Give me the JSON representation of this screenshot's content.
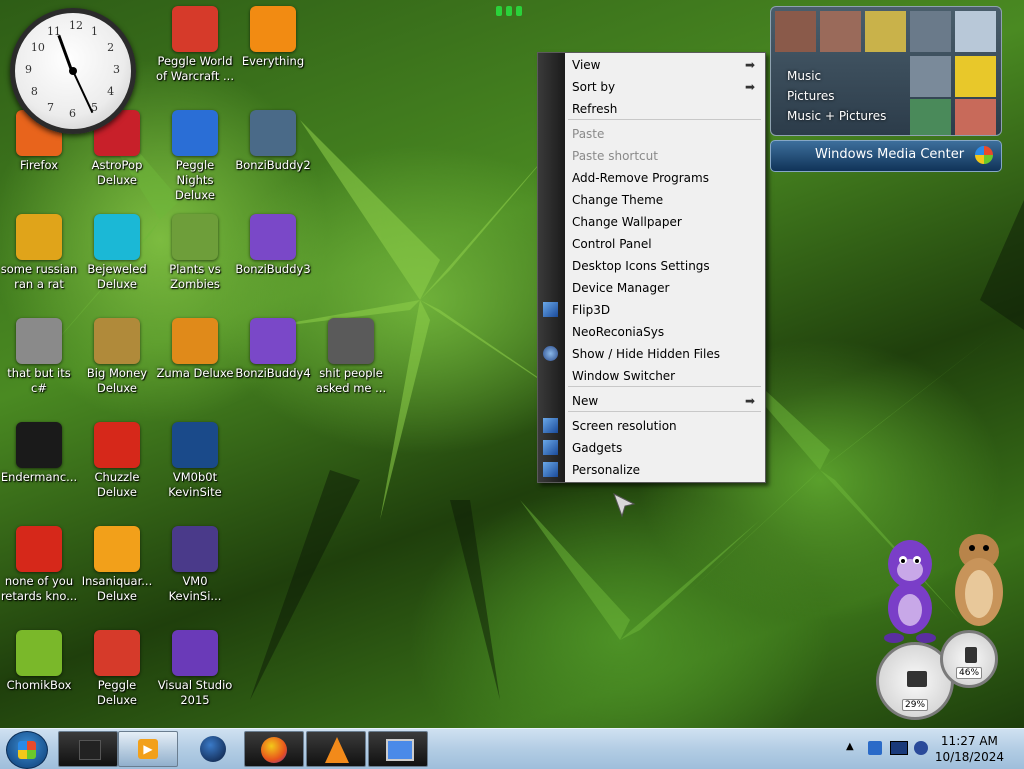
{
  "desktop_icons": [
    {
      "label": "Peggle World of Warcraft ...",
      "icon": "peggle-icon",
      "color": "#d63a2a"
    },
    {
      "label": "Everything",
      "icon": "magnifier-icon",
      "color": "#f28b12"
    },
    {
      "label": "Firefox",
      "icon": "firefox-icon",
      "color": "#e8641c"
    },
    {
      "label": "AstroPop Deluxe",
      "icon": "astropop-icon",
      "color": "#c8202a"
    },
    {
      "label": "Peggle Nights Deluxe",
      "icon": "peggle-nights-icon",
      "color": "#2a6ed6"
    },
    {
      "label": "BonziBuddy2",
      "icon": "window-icon",
      "color": "#4a6a88"
    },
    {
      "label": "some russian ran a rat",
      "icon": "de-icon",
      "color": "#e0a41a"
    },
    {
      "label": "Bejeweled Deluxe",
      "icon": "gem-icon",
      "color": "#1bb8d6"
    },
    {
      "label": "Plants vs Zombies",
      "icon": "flower-icon",
      "color": "#6e9e3a"
    },
    {
      "label": "BonziBuddy3",
      "icon": "bonzi-icon",
      "color": "#7a48c8"
    },
    {
      "label": "that but its c#",
      "icon": "files-icon",
      "color": "#8a8a8a"
    },
    {
      "label": "Big Money Deluxe",
      "icon": "money-bag-icon",
      "color": "#b08a3a"
    },
    {
      "label": "Zuma Deluxe",
      "icon": "zuma-icon",
      "color": "#e08a1a"
    },
    {
      "label": "BonziBuddy4",
      "icon": "bonzi-icon",
      "color": "#7a48c8"
    },
    {
      "label": "shit people asked me ...",
      "icon": "folder-icon",
      "color": "#5a5a5a"
    },
    {
      "label": "Endermanc...",
      "icon": "terminal-icon",
      "color": "#1a1a1a"
    },
    {
      "label": "Chuzzle Deluxe",
      "icon": "chuzzle-icon",
      "color": "#d6281a"
    },
    {
      "label": "VM0b0t KevinSite",
      "icon": "vm-icon",
      "color": "#1a4a8a"
    },
    {
      "label": "none of you retards kno...",
      "icon": "dragon-icon",
      "color": "#d6281a"
    },
    {
      "label": "Insaniquar... Deluxe",
      "icon": "fish-icon",
      "color": "#f2a01a"
    },
    {
      "label": "VM0 KevinSi...",
      "icon": "firefox-doc-icon",
      "color": "#4a3a8a"
    },
    {
      "label": "ChomikBox",
      "icon": "hamster-box-icon",
      "color": "#7ab82a"
    },
    {
      "label": "Peggle Deluxe",
      "icon": "peggle-icon",
      "color": "#d63a2a"
    },
    {
      "label": "Visual Studio 2015",
      "icon": "visual-studio-icon",
      "color": "#6a3ab8"
    }
  ],
  "clock_numbers": [
    "12",
    "1",
    "2",
    "3",
    "4",
    "5",
    "6",
    "7",
    "8",
    "9",
    "10",
    "11"
  ],
  "context_menu": {
    "items": [
      {
        "label": "View",
        "submenu": true,
        "disabled": false
      },
      {
        "label": "Sort by",
        "submenu": true,
        "disabled": false
      },
      {
        "label": "Refresh",
        "submenu": false,
        "disabled": false
      },
      {
        "label": "Paste",
        "submenu": false,
        "disabled": true
      },
      {
        "label": "Paste shortcut",
        "submenu": false,
        "disabled": true
      },
      {
        "label": "Add-Remove Programs",
        "submenu": false,
        "disabled": false
      },
      {
        "label": "Change Theme",
        "submenu": false,
        "disabled": false
      },
      {
        "label": "Change Wallpaper",
        "submenu": false,
        "disabled": false
      },
      {
        "label": "Control Panel",
        "submenu": false,
        "disabled": false
      },
      {
        "label": "Desktop Icons Settings",
        "submenu": false,
        "disabled": false
      },
      {
        "label": "Device Manager",
        "submenu": false,
        "disabled": false
      },
      {
        "label": "Flip3D",
        "submenu": false,
        "disabled": false,
        "icon": "flip3d-icon"
      },
      {
        "label": "NeoReconiaSys",
        "submenu": false,
        "disabled": false
      },
      {
        "label": "Show / Hide Hidden Files",
        "submenu": false,
        "disabled": false,
        "icon": "globe-icon"
      },
      {
        "label": "Window Switcher",
        "submenu": false,
        "disabled": false
      },
      {
        "label": "New",
        "submenu": true,
        "disabled": false
      },
      {
        "label": "Screen resolution",
        "submenu": false,
        "disabled": false,
        "icon": "display-icon"
      },
      {
        "label": "Gadgets",
        "submenu": false,
        "disabled": false,
        "icon": "gadgets-icon"
      },
      {
        "label": "Personalize",
        "submenu": false,
        "disabled": false,
        "icon": "personalize-icon"
      }
    ]
  },
  "media_center": {
    "labels": [
      "Music",
      "Pictures",
      "Music + Pictures"
    ],
    "brand": "Windows Media Center"
  },
  "taskbar": {
    "time": "11:27 AM",
    "date": "10/18/2024",
    "buttons": [
      "media-player-icon",
      "firefox-icon",
      "vlc-icon",
      "remote-desktop-icon"
    ]
  },
  "gauges": {
    "cpu_percent": "29%",
    "memory_percent": "46%"
  }
}
